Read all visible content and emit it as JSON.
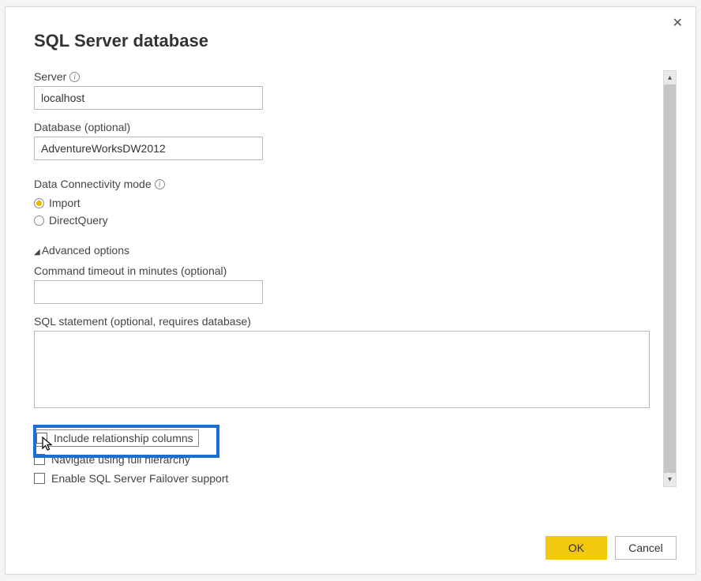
{
  "dialog": {
    "title": "SQL Server database",
    "server": {
      "label": "Server",
      "value": "localhost"
    },
    "database": {
      "label": "Database (optional)",
      "value": "AdventureWorksDW2012"
    },
    "connectivity": {
      "label": "Data Connectivity mode",
      "options": {
        "import": "Import",
        "directquery": "DirectQuery"
      }
    },
    "advanced": {
      "toggle_label": "Advanced options",
      "timeout_label": "Command timeout in minutes (optional)",
      "timeout_value": "",
      "sql_label": "SQL statement (optional, requires database)",
      "sql_value": ""
    },
    "checks": {
      "include_rel": "Include relationship columns",
      "nav_hierarchy": "Navigate using full hierarchy",
      "failover": "Enable SQL Server Failover support"
    },
    "buttons": {
      "ok": "OK",
      "cancel": "Cancel"
    }
  }
}
